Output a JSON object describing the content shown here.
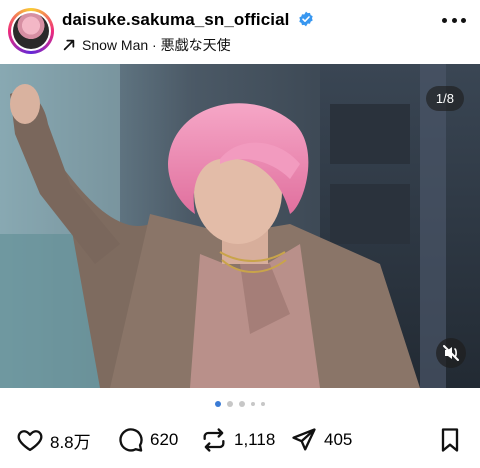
{
  "post": {
    "username": "daisuke.sakuma_sn_official",
    "subline": "Snow Man · 悪戯な天使",
    "image_counter": "1/8"
  },
  "actions": {
    "likes": "8.8万",
    "comments": "620",
    "reposts": "1,118",
    "shares": "405"
  },
  "carousel": {
    "total_dots": 5,
    "active_index": 0
  },
  "colors": {
    "verified": "#3897f0",
    "active_dot": "#3a7bd5"
  }
}
